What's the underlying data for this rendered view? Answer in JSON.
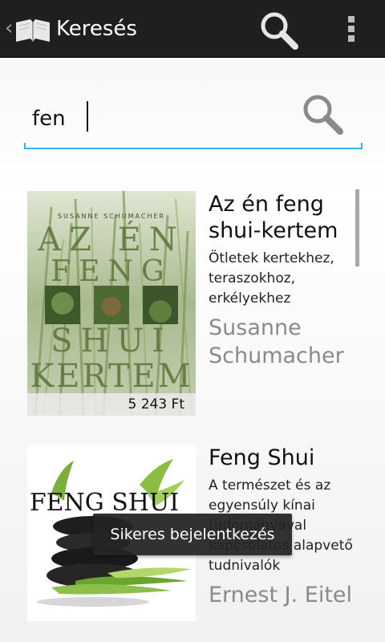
{
  "action_bar": {
    "title": "Keresés",
    "icons": [
      "app-book-logo",
      "search-icon",
      "overflow-menu-icon"
    ]
  },
  "search": {
    "query": "fen",
    "icon": "search-icon",
    "accent_color": "#33b5e5"
  },
  "results": [
    {
      "title": "Az én feng shui-kertem",
      "subtitle": "Ötletek kertekhez, teraszokhoz, erkélyekhez",
      "author": "Susanne Schumacher",
      "price": "5 243 Ft",
      "cover": {
        "top_text": "SUSANNE SCHUMACHER",
        "line1": "AZ ÉN",
        "line2": "FENG",
        "line3": "SHUI",
        "line4": "KERTEM"
      }
    },
    {
      "title": "Feng Shui",
      "subtitle": "A természet és az egyensúly kínai tudományával kapcsolatos alapvető tudnivalók",
      "author": "Ernest J. Eitel",
      "cover": {
        "line1": "FENG SHUI"
      }
    }
  ],
  "toast": {
    "message": "Sikeres bejelentkezés"
  }
}
